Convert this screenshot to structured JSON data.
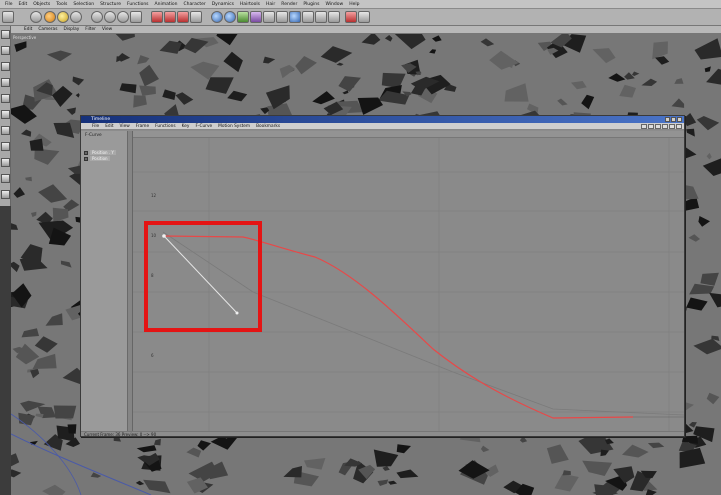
{
  "app_menu": [
    "File",
    "Edit",
    "Objects",
    "Tools",
    "Selection",
    "Structure",
    "Functions",
    "Animation",
    "Character",
    "Dynamics",
    "Hairtools",
    "Hair",
    "Render",
    "Plugins",
    "Window",
    "Help"
  ],
  "viewport": {
    "menu": [
      "Edit",
      "Cameras",
      "Display",
      "Filter",
      "View"
    ],
    "label": "Perspective"
  },
  "timeline": {
    "title": "Timeline",
    "menu": [
      "File",
      "Edit",
      "View",
      "Frame",
      "Functions",
      "Key",
      "F-Curve",
      "Motion System",
      "Bookmarks"
    ],
    "left_header": "F-Curve",
    "tracks": [
      {
        "label": "Position . Y"
      },
      {
        "label": "Position"
      }
    ],
    "status_text": "Current Frame: 36  Preview: 0 --> 90",
    "y_ticks": [
      "12",
      "10",
      "8",
      "6"
    ],
    "curve_color": "#e84848"
  },
  "highlight_color": "#e41414"
}
